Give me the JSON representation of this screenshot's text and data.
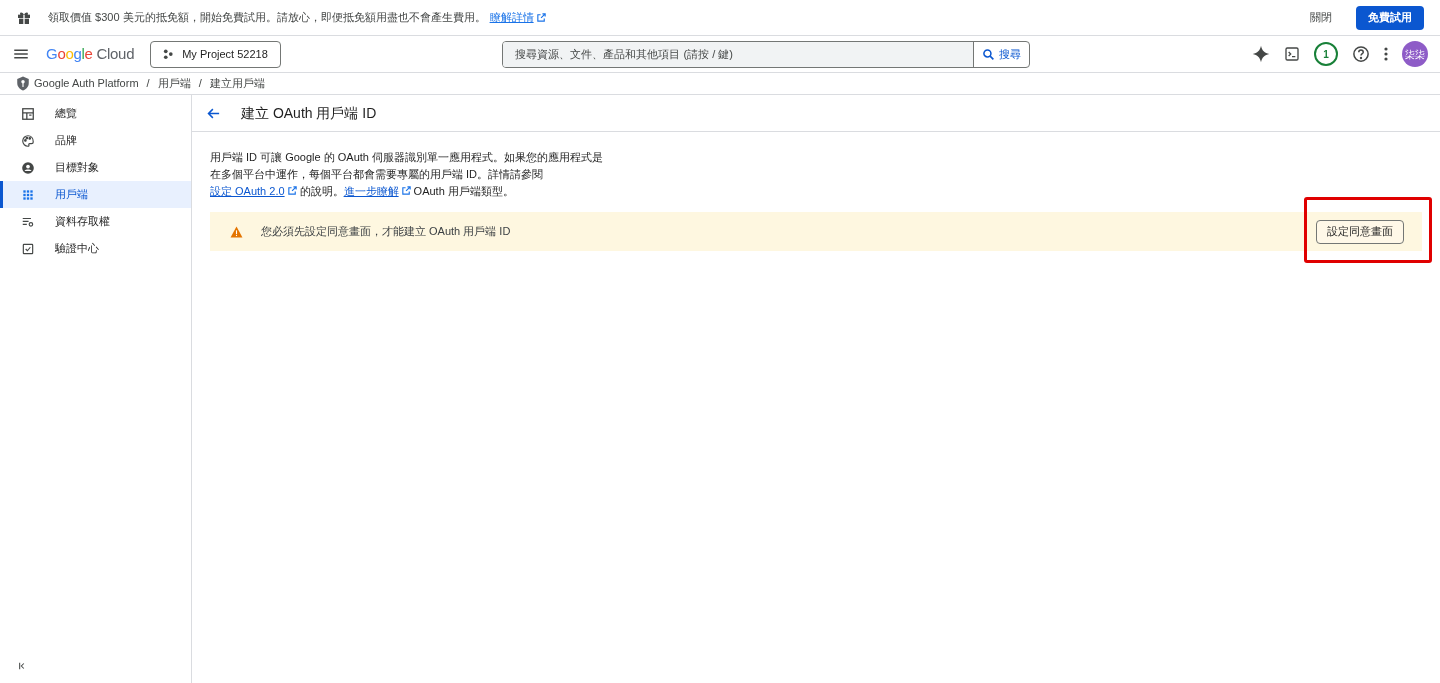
{
  "promo_banner": {
    "message": "領取價值 $300 美元的抵免額，開始免費試用。請放心，即便抵免額用盡也不會產生費用。",
    "link": "瞭解詳情",
    "dismiss": "關閉",
    "cta": "免費試用"
  },
  "header": {
    "logo": {
      "brand": "Google",
      "product": "Cloud"
    },
    "project": "My Project 52218",
    "search": {
      "placeholder": "搜尋資源、文件、產品和其他項目 (請按 / 鍵)",
      "button": "搜尋"
    },
    "notification_count": "1",
    "avatar": "柒柒"
  },
  "breadcrumb": {
    "separator": "/",
    "items": [
      "Google Auth Platform",
      "用戶端",
      "建立用戶端"
    ]
  },
  "sidebar": {
    "items": [
      {
        "label": "總覽",
        "kind": "overview",
        "selected": false
      },
      {
        "label": "品牌",
        "kind": "branding",
        "selected": false
      },
      {
        "label": "目標對象",
        "kind": "audience",
        "selected": false
      },
      {
        "label": "用戶端",
        "kind": "clients",
        "selected": true
      },
      {
        "label": "資料存取權",
        "kind": "data-access",
        "selected": false
      },
      {
        "label": "驗證中心",
        "kind": "verification",
        "selected": false
      }
    ]
  },
  "page": {
    "title": "建立 OAuth 用戶端 ID",
    "description": [
      {
        "text": "用戶端 ID 可讓 Google 的 OAuth 伺服器識別單一應用程式。如果您的應用程式是在多個平台中運作，每個平台都會需要專屬的用戶端 ID。詳情請參閱",
        "kind": "text"
      },
      {
        "text": "設定 OAuth 2.0",
        "kind": "link"
      },
      {
        "text": "的說明。",
        "kind": "text"
      },
      {
        "text": "進一步瞭解",
        "kind": "link"
      },
      {
        "text": "OAuth 用戶端類型。",
        "kind": "text"
      }
    ],
    "warning": {
      "message": "您必須先設定同意畫面，才能建立 OAuth 用戶端 ID",
      "button": "設定同意畫面",
      "highlighted": true
    }
  }
}
